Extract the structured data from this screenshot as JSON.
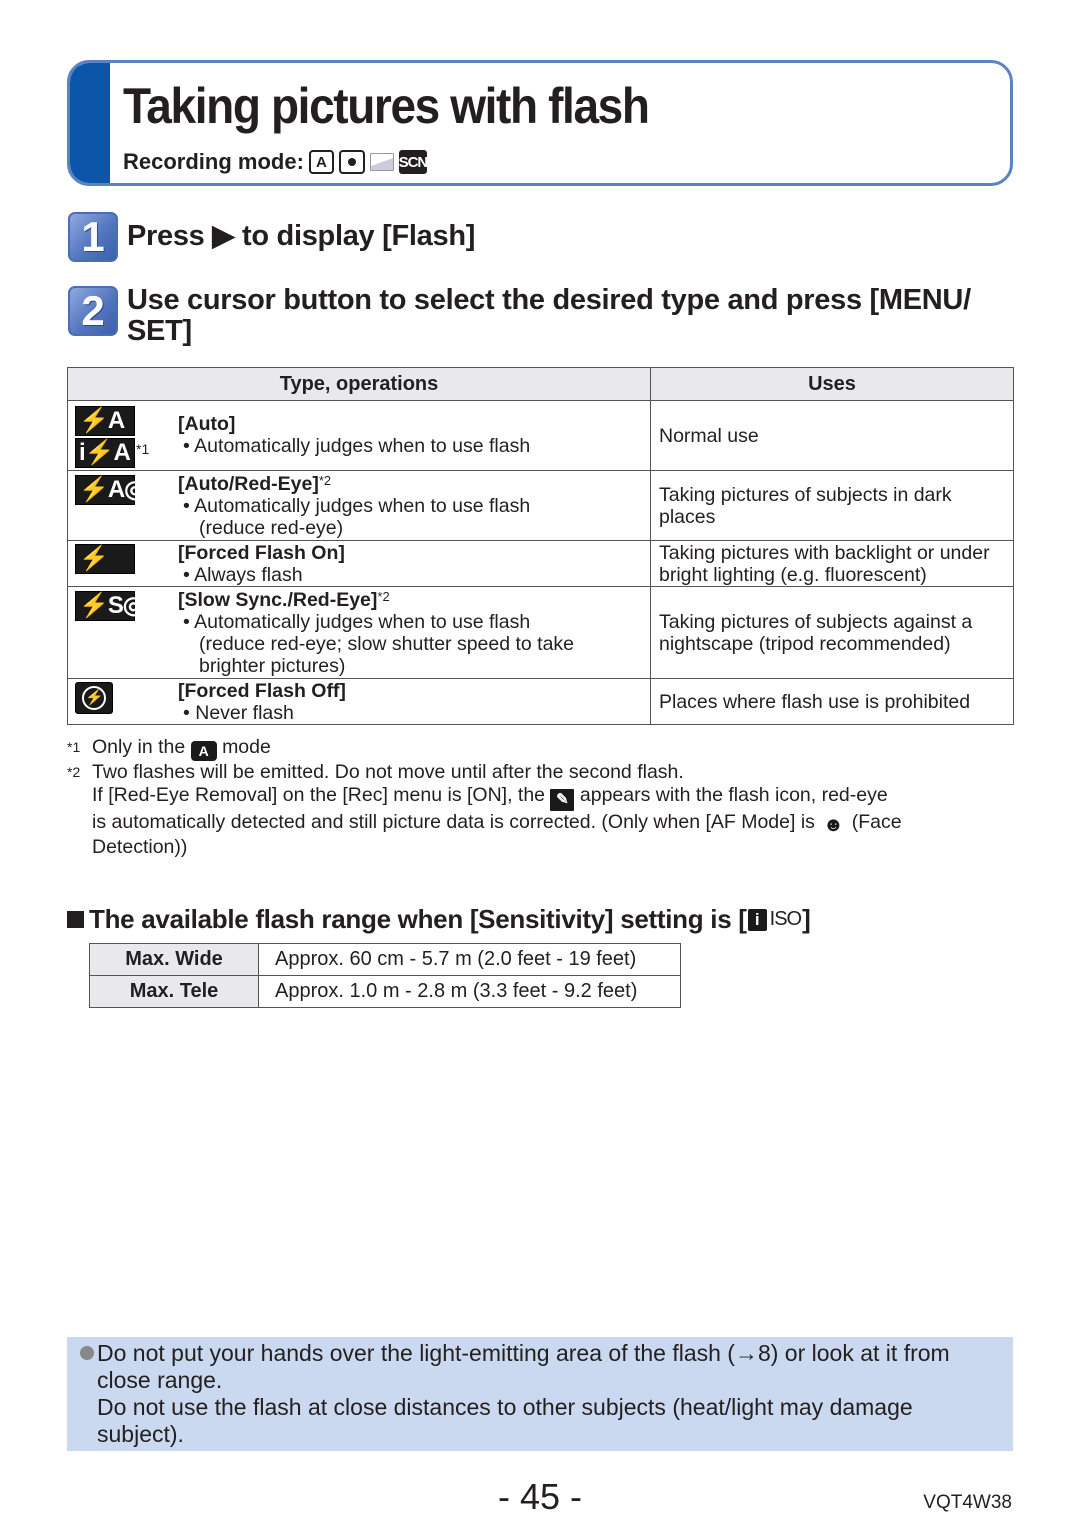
{
  "header": {
    "title": "Taking pictures with flash",
    "recording_mode_label": "Recording mode:",
    "mode_icons": [
      {
        "name": "intelligent-auto-icon",
        "glyph": "A"
      },
      {
        "name": "normal-picture-icon",
        "glyph": ""
      },
      {
        "name": "panorama-icon",
        "glyph": ""
      },
      {
        "name": "scene-mode-icon",
        "glyph": "SCN"
      }
    ],
    "accent_color": "#0b56a8",
    "border_color": "#5b82c4"
  },
  "steps": [
    {
      "number": "1",
      "text": "Press ▶ to display [Flash]"
    },
    {
      "number": "2",
      "text": "Use cursor button to select the desired type and press [MENU/ SET]"
    }
  ],
  "flash_table": {
    "headers": [
      "Type, operations",
      "Uses"
    ],
    "rows": [
      {
        "icons": [
          "⚡A",
          "i⚡A"
        ],
        "icon_note": "*1",
        "title": "[Auto]",
        "title_note": "",
        "lines": [
          "• Automatically judges when to use flash"
        ],
        "use": "Normal use"
      },
      {
        "icons": [
          "⚡A◎"
        ],
        "title": "[Auto/Red-Eye]",
        "title_note": "*2",
        "lines": [
          "• Automatically judges when to use flash",
          "(reduce red-eye)"
        ],
        "use": "Taking pictures of subjects in dark places"
      },
      {
        "icons": [
          "⚡"
        ],
        "title": "[Forced Flash On]",
        "title_note": "",
        "lines": [
          "• Always flash"
        ],
        "use": "Taking pictures with backlight or under bright lighting (e.g. fluorescent)"
      },
      {
        "icons": [
          "⚡S◎"
        ],
        "title": "[Slow Sync./Red-Eye]",
        "title_note": "*2",
        "lines": [
          "• Automatically judges when to use flash",
          "(reduce red-eye; slow shutter speed to take",
          "brighter pictures)"
        ],
        "use": "Taking pictures of subjects against a nightscape (tripod recommended)"
      },
      {
        "icons": [
          "⊘"
        ],
        "title": "[Forced Flash Off]",
        "title_note": "",
        "lines": [
          "• Never flash"
        ],
        "use": "Places where flash use is prohibited"
      }
    ]
  },
  "footnotes": {
    "note1_mark": "*1",
    "note1_pre": "Only in the",
    "note1_icon": "A",
    "note1_post": "mode",
    "note2_mark": "*2",
    "note2_line1": "Two flashes will be emitted. Do not move until after the second flash.",
    "note2_line2_pre": "If [Red-Eye Removal] on the [Rec] menu is [ON], the",
    "note2_line2_post": "appears with the flash icon, red-eye",
    "note2_line3_pre": "is automatically detected and still picture data is corrected. (Only when [AF Mode] is",
    "note2_line3_post": "(Face",
    "note2_line4": "Detection))"
  },
  "range_section": {
    "heading_pre": "The available flash range when [Sensitivity] setting is [",
    "heading_icon_i": "i",
    "heading_icon_iso": "ISO",
    "heading_post": "]",
    "rows": [
      {
        "label": "Max. Wide",
        "value": "Approx. 60 cm - 5.7 m (2.0 feet - 19 feet)"
      },
      {
        "label": "Max. Tele",
        "value": "Approx. 1.0 m - 2.8 m (3.3 feet - 9.2 feet)"
      }
    ]
  },
  "caution": {
    "para1": "Do not put your hands over the light-emitting area of the flash (→8) or look at it from close range.",
    "para2": "Do not use the flash at close distances to other subjects (heat/light may damage subject).",
    "background_color": "#cad9f0"
  },
  "footer": {
    "page_number": "- 45 -",
    "doc_code": "VQT4W38"
  }
}
